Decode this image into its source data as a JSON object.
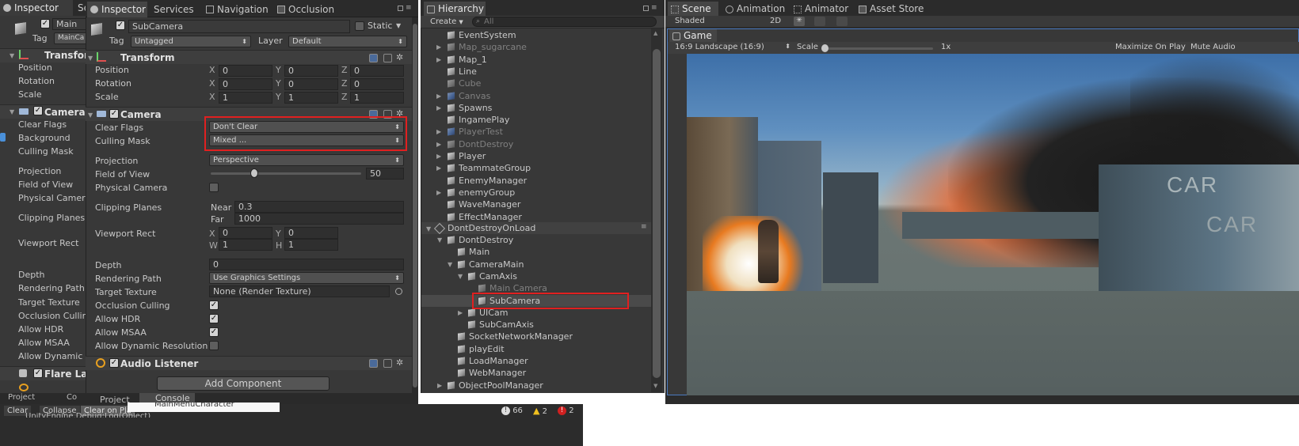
{
  "inspector_left": {
    "tab": "Inspector",
    "tab2": "Se",
    "object_name": "Main Ca",
    "tag_label": "Tag",
    "tag_value": "MainCa",
    "transform_title": "Transfor",
    "transform_rows": [
      "Position",
      "Rotation",
      "Scale"
    ],
    "camera_title": "Camera",
    "camera_rows": [
      "Clear Flags",
      "Background",
      "Culling Mask",
      "Projection",
      "Field of View",
      "Physical Camera",
      "Clipping Planes",
      "Viewport Rect",
      "Depth",
      "Rendering Path",
      "Target Texture",
      "Occlusion Cullin",
      "Allow HDR",
      "Allow MSAA",
      "Allow Dynamic R"
    ],
    "flare_title": "Flare Lay",
    "bottom_tab1": "Project",
    "bottom_tab2": "Co"
  },
  "inspector": {
    "tabs": [
      "Inspector",
      "Services",
      "Navigation",
      "Occlusion"
    ],
    "object_name": "SubCamera",
    "static_label": "Static",
    "tag_label": "Tag",
    "tag_value": "Untagged",
    "layer_label": "Layer",
    "layer_value": "Default",
    "transform": {
      "title": "Transform",
      "rows": [
        {
          "label": "Position",
          "x": "0",
          "y": "0",
          "z": "0"
        },
        {
          "label": "Rotation",
          "x": "0",
          "y": "0",
          "z": "0"
        },
        {
          "label": "Scale",
          "x": "1",
          "y": "1",
          "z": "1"
        }
      ],
      "axis_x": "X",
      "axis_y": "Y",
      "axis_z": "Z"
    },
    "camera": {
      "title": "Camera",
      "clear_flags_label": "Clear Flags",
      "clear_flags_value": "Don't Clear",
      "culling_mask_label": "Culling Mask",
      "culling_mask_value": "Mixed ...",
      "projection_label": "Projection",
      "projection_value": "Perspective",
      "fov_label": "Field of View",
      "fov_value": "50",
      "fov_fraction": 0.29,
      "physical_label": "Physical Camera",
      "clipping_label": "Clipping Planes",
      "near_label": "Near",
      "near_value": "0.3",
      "far_label": "Far",
      "far_value": "1000",
      "viewport_label": "Viewport Rect",
      "vp_x_label": "X",
      "vp_x": "0",
      "vp_y_label": "Y",
      "vp_y": "0",
      "vp_w_label": "W",
      "vp_w": "1",
      "vp_h_label": "H",
      "vp_h": "1",
      "depth_label": "Depth",
      "depth_value": "0",
      "rendering_label": "Rendering Path",
      "rendering_value": "Use Graphics Settings",
      "target_label": "Target Texture",
      "target_value": "None (Render Texture)",
      "occlusion_label": "Occlusion Culling",
      "hdr_label": "Allow HDR",
      "msaa_label": "Allow MSAA",
      "dynres_label": "Allow Dynamic Resolution"
    },
    "audio_title": "Audio Listener",
    "add_component": "Add Component",
    "bottom_tabs": [
      "Project",
      "Console"
    ]
  },
  "hierarchy": {
    "tab": "Hierarchy",
    "create_label": "Create",
    "search_placeholder": "All",
    "items": [
      {
        "name": "EventSystem",
        "style": "normal",
        "indent": 0,
        "fold": false
      },
      {
        "name": "Map_sugarcane",
        "style": "dim",
        "indent": 0,
        "fold": true
      },
      {
        "name": "Map_1",
        "style": "normal",
        "indent": 0,
        "fold": true
      },
      {
        "name": "Line",
        "style": "normal",
        "indent": 0,
        "fold": false
      },
      {
        "name": "Cube",
        "style": "dim",
        "indent": 0,
        "fold": false
      },
      {
        "name": "Canvas",
        "style": "dim",
        "indent": 0,
        "fold": true
      },
      {
        "name": "Spawns",
        "style": "normal",
        "indent": 0,
        "fold": true
      },
      {
        "name": "IngamePlay",
        "style": "normal",
        "indent": 0,
        "fold": false
      },
      {
        "name": "PlayerTest",
        "style": "dim",
        "indent": 0,
        "fold": true
      },
      {
        "name": "DontDestroy",
        "style": "dim",
        "indent": 0,
        "fold": true
      },
      {
        "name": "Player",
        "style": "normal",
        "indent": 0,
        "fold": true
      },
      {
        "name": "TeammateGroup",
        "style": "normal",
        "indent": 0,
        "fold": true
      },
      {
        "name": "EnemyManager",
        "style": "normal",
        "indent": 0,
        "fold": false
      },
      {
        "name": "enemyGroup",
        "style": "normal",
        "indent": 0,
        "fold": true
      },
      {
        "name": "WaveManager",
        "style": "normal",
        "indent": 0,
        "fold": false
      },
      {
        "name": "EffectManager",
        "style": "normal",
        "indent": 0,
        "fold": false
      }
    ],
    "ddol_label": "DontDestroyOnLoad",
    "ddol_items": [
      {
        "name": "DontDestroy",
        "indent": 1,
        "fold": "open",
        "style": "normal"
      },
      {
        "name": "Main",
        "indent": 2,
        "fold": "none",
        "style": "normal"
      },
      {
        "name": "CameraMain",
        "indent": 2,
        "fold": "open",
        "style": "normal"
      },
      {
        "name": "CamAxis",
        "indent": 3,
        "fold": "open",
        "style": "normal"
      },
      {
        "name": "Main Camera",
        "indent": 4,
        "fold": "none",
        "style": "dim"
      },
      {
        "name": "SubCamera",
        "indent": 4,
        "fold": "none",
        "style": "selected"
      },
      {
        "name": "UICam",
        "indent": 3,
        "fold": "closed",
        "style": "normal"
      },
      {
        "name": "SubCamAxis",
        "indent": 3,
        "fold": "none",
        "style": "normal"
      },
      {
        "name": "SocketNetworkManager",
        "indent": 2,
        "fold": "none",
        "style": "normal"
      },
      {
        "name": "playEdit",
        "indent": 2,
        "fold": "none",
        "style": "normal"
      },
      {
        "name": "LoadManager",
        "indent": 2,
        "fold": "none",
        "style": "normal"
      },
      {
        "name": "WebManager",
        "indent": 2,
        "fold": "none",
        "style": "normal"
      },
      {
        "name": "ObjectPoolManager",
        "indent": 1,
        "fold": "closed",
        "style": "normal"
      }
    ]
  },
  "scene_tabs": [
    "Scene",
    "Animation",
    "Animator",
    "Asset Store"
  ],
  "scene_toolbar": {
    "shaded": "Shaded",
    "mode2d": "2D"
  },
  "game": {
    "tab": "Game",
    "aspect": "16:9 Landscape (16:9)",
    "scale_label": "Scale",
    "scale_value": "1x",
    "maximize": "Maximize On Play",
    "mute": "Mute Audio",
    "container_text": "CAR"
  },
  "console": {
    "clear": "Clear",
    "collapse": "Collapse",
    "clear_on_play": "Clear on Pla",
    "popup_text": "MainMenuCharacter",
    "stale_text": "UnityEngine.Debug:Log(Object)",
    "log_count": "66",
    "warn_count": "2",
    "error_count": "2"
  }
}
